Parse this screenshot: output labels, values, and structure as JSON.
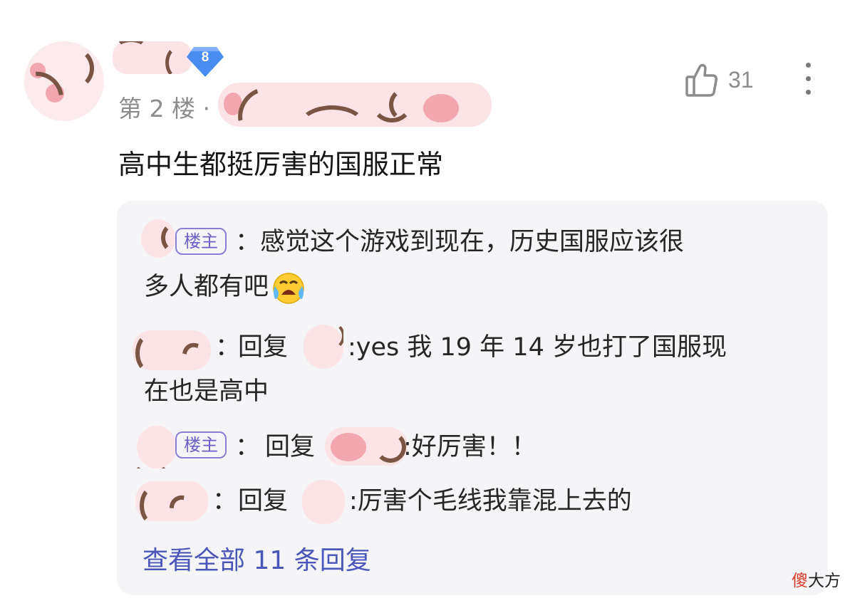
{
  "header": {
    "level_badge": "8",
    "floor_label": "第 2 楼 ·",
    "like_count": "31"
  },
  "comment": {
    "text": "高中生都挺厉害的国服正常"
  },
  "replies": {
    "op_tag": "楼主",
    "r1_line1": "：感觉这个游戏到现在，历史国服应该很",
    "r1_line2": "多人都有吧",
    "r2_colon": "：",
    "r2_reply": "回复",
    "r2_line1": ":yes 我 19 年 14 岁也打了国服现",
    "r2_line2": "在也是高中",
    "r3_colon": "：",
    "r3_reply": "回复",
    "r3_text": ":好厉害！！",
    "r4_colon": "：",
    "r4_reply": "回复",
    "r4_text": ":厉害个毛线我靠混上去的",
    "view_all": "查看全部 11 条回复"
  },
  "watermark": {
    "part1": "傻",
    "part2": "大方"
  },
  "icons": [
    "thumbs-up-icon",
    "more-vertical-icon",
    "crying-emoji-icon",
    "level-diamond-icon"
  ]
}
